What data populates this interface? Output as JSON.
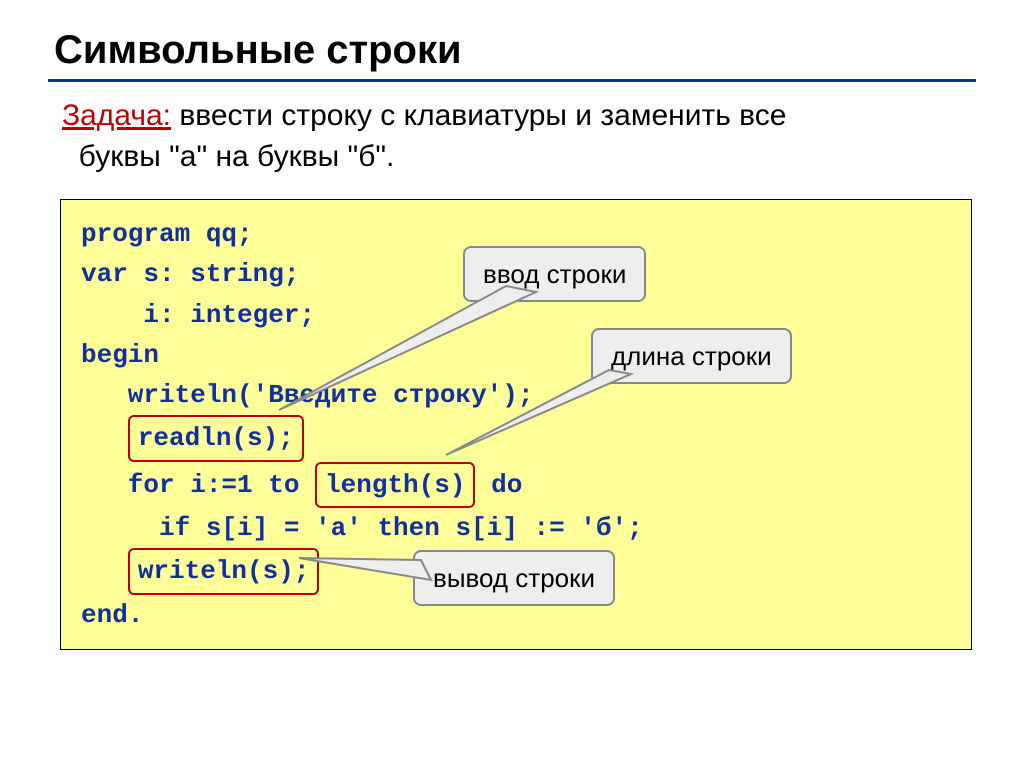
{
  "title": "Символьные строки",
  "task_label": "Задача:",
  "task_text": " ввести строку с клавиатуры и заменить все\n  буквы \"а\" на буквы \"б\".",
  "code": {
    "l1": "program qq;",
    "l2": "var s: string;",
    "l3": "    i: integer;",
    "l4": "begin",
    "l5a": "   writeln('Введи",
    "l5b": " строку');",
    "l5m": "те",
    "l6_emph": "readln(s);",
    "l7a": "   for i:=1 to ",
    "l7_emph": "length(s)",
    "l7b": " do",
    "l8": "     if s[i] = 'а' then s[i] := 'б';",
    "l9_emph": "writeln(s);",
    "l10": "end."
  },
  "callouts": {
    "input": "ввод строки",
    "length": "длина строки",
    "output": "вывод строки"
  }
}
